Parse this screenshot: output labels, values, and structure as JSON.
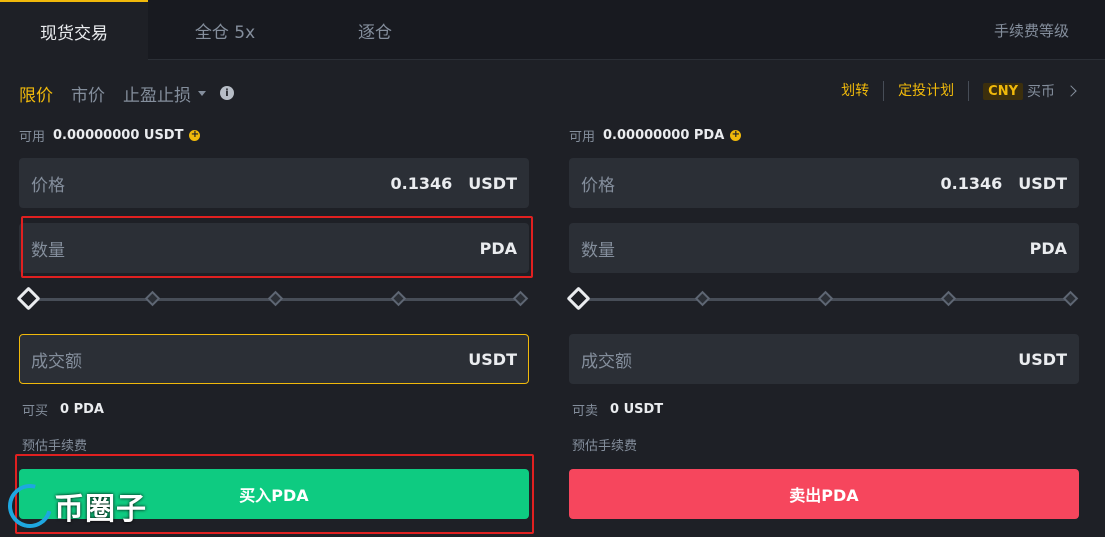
{
  "tabs": {
    "spot": "现货交易",
    "cross": "全仓 5x",
    "isolated": "逐仓",
    "fee_level": "手续费等级"
  },
  "order_types": {
    "limit": "限价",
    "market": "市价",
    "stop": "止盈止损"
  },
  "links": {
    "transfer": "划转",
    "auto_invest": "定投计划",
    "currency_badge": "CNY",
    "buy_crypto": "买币"
  },
  "buy": {
    "available_label": "可用",
    "available_value": "0.00000000 USDT",
    "price_label": "价格",
    "price_value": "0.1346",
    "price_unit": "USDT",
    "qty_label": "数量",
    "qty_unit": "PDA",
    "total_label": "成交额",
    "total_unit": "USDT",
    "can_label": "可买",
    "can_value": "0 PDA",
    "fee_label": "预估手续费",
    "button": "买入PDA"
  },
  "sell": {
    "available_label": "可用",
    "available_value": "0.00000000 PDA",
    "price_label": "价格",
    "price_value": "0.1346",
    "price_unit": "USDT",
    "qty_label": "数量",
    "qty_unit": "PDA",
    "total_label": "成交额",
    "total_unit": "USDT",
    "can_label": "可卖",
    "can_value": "0 USDT",
    "fee_label": "预估手续费",
    "button": "卖出PDA"
  },
  "watermark": {
    "text": "币圈子"
  },
  "colors": {
    "accent": "#f0b90b",
    "buy": "#0ecb81",
    "sell": "#f6465d",
    "annotation": "#e02020"
  }
}
